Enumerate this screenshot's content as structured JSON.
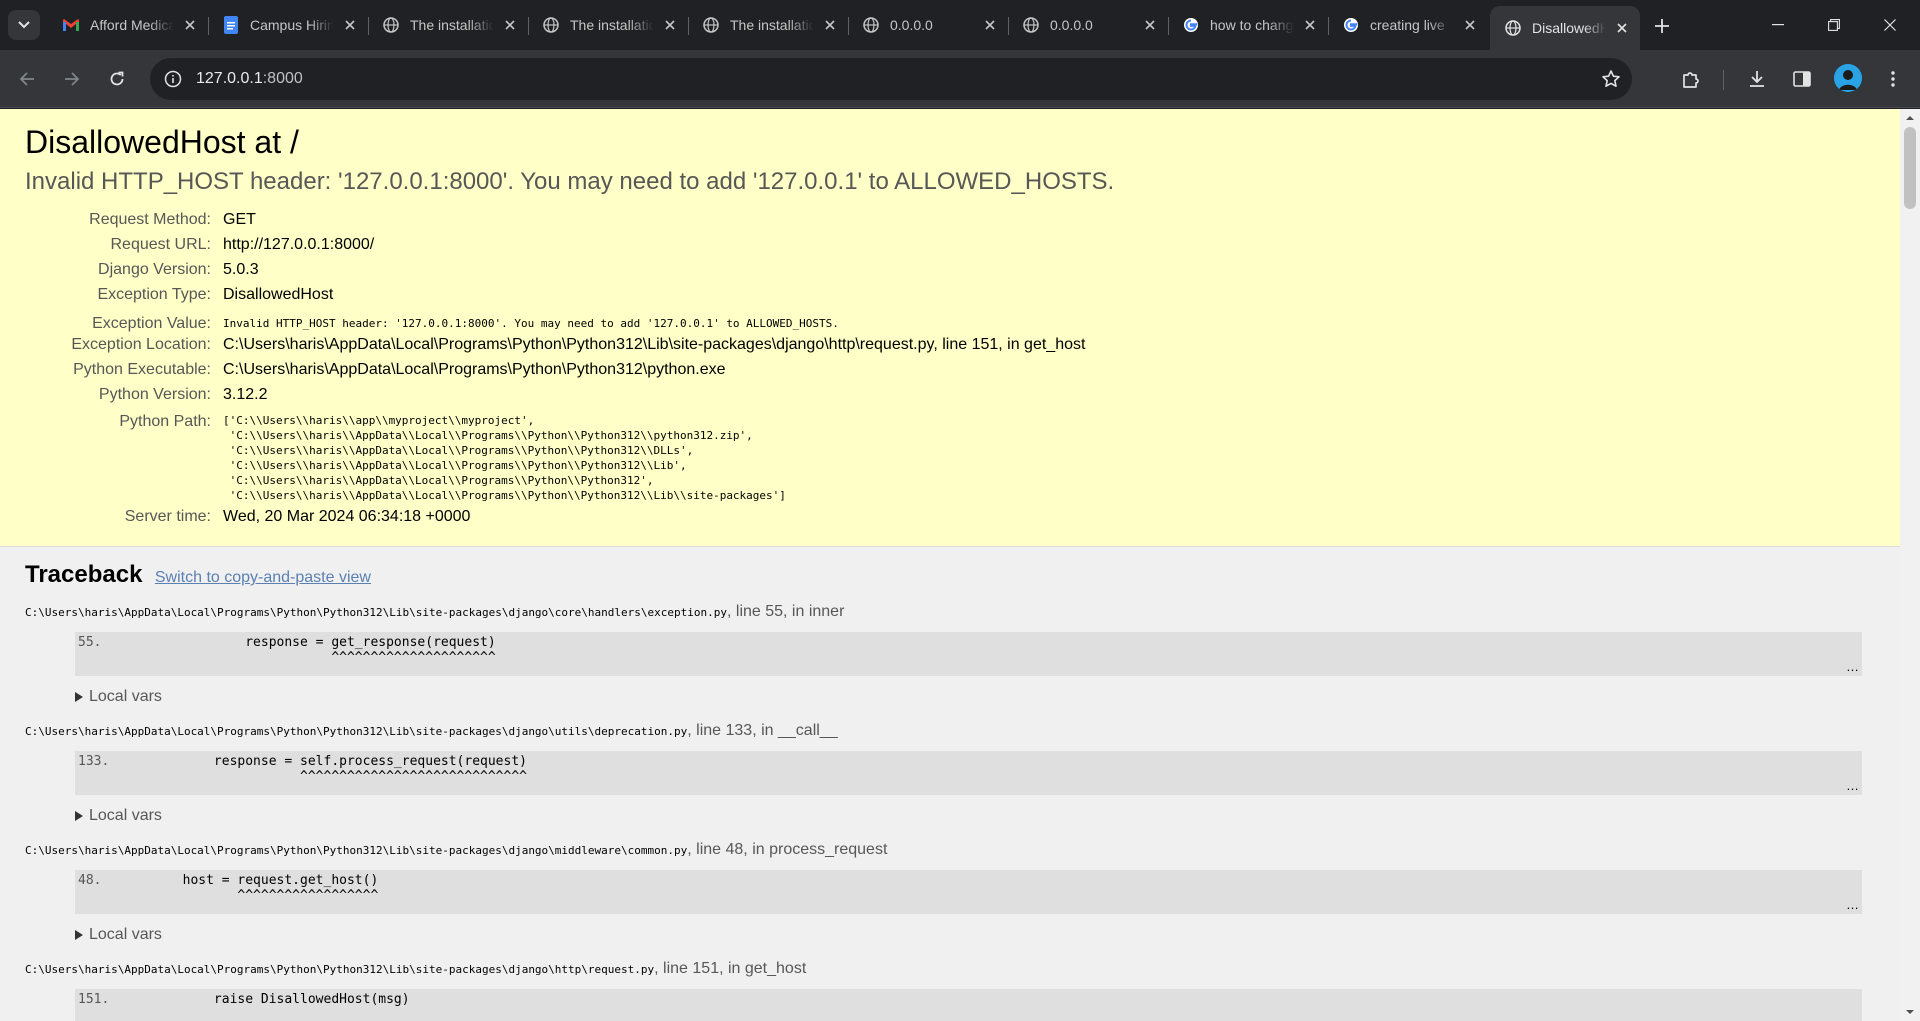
{
  "browser": {
    "tabs": [
      {
        "title": "Afford Medical",
        "icon": "gmail-icon"
      },
      {
        "title": "Campus Hiring",
        "icon": "docs-icon"
      },
      {
        "title": "The installation",
        "icon": "globe-icon"
      },
      {
        "title": "The installation",
        "icon": "globe-icon"
      },
      {
        "title": "The installation",
        "icon": "globe-icon"
      },
      {
        "title": "0.0.0.0",
        "icon": "globe-icon"
      },
      {
        "title": "0.0.0.0",
        "icon": "globe-icon"
      },
      {
        "title": "how to change",
        "icon": "google-icon"
      },
      {
        "title": "creating live",
        "icon": "google-icon"
      },
      {
        "title": "DisallowedHost",
        "icon": "globe-icon",
        "active": true
      }
    ],
    "url_host": "127.0.0.1",
    "url_rest": ":8000"
  },
  "page": {
    "title": "DisallowedHost at /",
    "subtitle": "Invalid HTTP_HOST header: '127.0.0.1:8000'. You may need to add '127.0.0.1' to ALLOWED_HOSTS.",
    "meta": {
      "request_method_label": "Request Method:",
      "request_method": "GET",
      "request_url_label": "Request URL:",
      "request_url": "http://127.0.0.1:8000/",
      "django_version_label": "Django Version:",
      "django_version": "5.0.3",
      "exception_type_label": "Exception Type:",
      "exception_type": "DisallowedHost",
      "exception_value_label": "Exception Value:",
      "exception_value": "Invalid HTTP_HOST header: '127.0.0.1:8000'. You may need to add '127.0.0.1' to ALLOWED_HOSTS.",
      "exception_location_label": "Exception Location:",
      "exception_location": "C:\\Users\\haris\\AppData\\Local\\Programs\\Python\\Python312\\Lib\\site-packages\\django\\http\\request.py, line 151, in get_host",
      "python_executable_label": "Python Executable:",
      "python_executable": "C:\\Users\\haris\\AppData\\Local\\Programs\\Python\\Python312\\python.exe",
      "python_version_label": "Python Version:",
      "python_version": "3.12.2",
      "python_path_label": "Python Path:",
      "python_path": "['C:\\\\Users\\\\haris\\\\app\\\\myproject\\\\myproject',\n 'C:\\\\Users\\\\haris\\\\AppData\\\\Local\\\\Programs\\\\Python\\\\Python312\\\\python312.zip',\n 'C:\\\\Users\\\\haris\\\\AppData\\\\Local\\\\Programs\\\\Python\\\\Python312\\\\DLLs',\n 'C:\\\\Users\\\\haris\\\\AppData\\\\Local\\\\Programs\\\\Python\\\\Python312\\\\Lib',\n 'C:\\\\Users\\\\haris\\\\AppData\\\\Local\\\\Programs\\\\Python\\\\Python312',\n 'C:\\\\Users\\\\haris\\\\AppData\\\\Local\\\\Programs\\\\Python\\\\Python312\\\\Lib\\\\site-packages']",
      "server_time_label": "Server time:",
      "server_time": "Wed, 20 Mar 2024 06:34:18 +0000"
    },
    "traceback": {
      "heading": "Traceback",
      "switch_link": "Switch to copy-and-paste view",
      "local_vars_label": "Local vars",
      "frames": [
        {
          "file": "C:\\Users\\haris\\AppData\\Local\\Programs\\Python\\Python312\\Lib\\site-packages\\django\\core\\handlers\\exception.py",
          "where": ", line 55, in inner",
          "lineno": "55.",
          "code": "                response = get_response(request)\n                           ^^^^^^^^^^^^^^^^^^^^^"
        },
        {
          "file": "C:\\Users\\haris\\AppData\\Local\\Programs\\Python\\Python312\\Lib\\site-packages\\django\\utils\\deprecation.py",
          "where": ", line 133, in __call__",
          "lineno": "133.",
          "code": "            response = self.process_request(request)\n                       ^^^^^^^^^^^^^^^^^^^^^^^^^^^^^"
        },
        {
          "file": "C:\\Users\\haris\\AppData\\Local\\Programs\\Python\\Python312\\Lib\\site-packages\\django\\middleware\\common.py",
          "where": ", line 48, in process_request",
          "lineno": "48.",
          "code": "        host = request.get_host()\n               ^^^^^^^^^^^^^^^^^^"
        },
        {
          "file": "C:\\Users\\haris\\AppData\\Local\\Programs\\Python\\Python312\\Lib\\site-packages\\django\\http\\request.py",
          "where": ", line 151, in get_host",
          "lineno": "151.",
          "code": "            raise DisallowedHost(msg)"
        }
      ],
      "more_marker": "…"
    }
  }
}
